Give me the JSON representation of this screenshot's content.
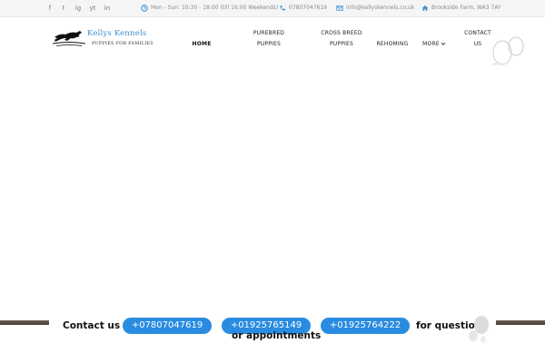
{
  "topbar": {
    "social": [
      "f",
      "t",
      "ig",
      "yt",
      "in"
    ],
    "hours": "Mon - Sun: 10:30 - 18:00 (till 16:00 Weekends)",
    "phone": "07807047619",
    "email": "info@kellyskennels.co.uk",
    "address": "Brookside Farm, WA3 7AY",
    "icon_color": "#3a8fd0"
  },
  "logo": {
    "title": "Kellys Kennels",
    "subtitle": "PUPPIES FOR FAMILIES"
  },
  "nav": {
    "home": "HOME",
    "purebred_1": "PUREBRED",
    "purebred_2": "PUPPIES",
    "crossbreed_1": "CROSS BREED",
    "crossbreed_2": "PUPPIES",
    "rehoming": "REHOMING",
    "more": "MORE",
    "contact_1": "CONTACT",
    "contact_2": "US"
  },
  "contact_bar": {
    "lead": "Contact us",
    "phone_1": "+07807047619",
    "phone_2": "+01925765149",
    "phone_3": "+01925764222",
    "tail_1": "for questions",
    "tail_2": "or appointments",
    "pill_color": "#2a8ce0"
  }
}
